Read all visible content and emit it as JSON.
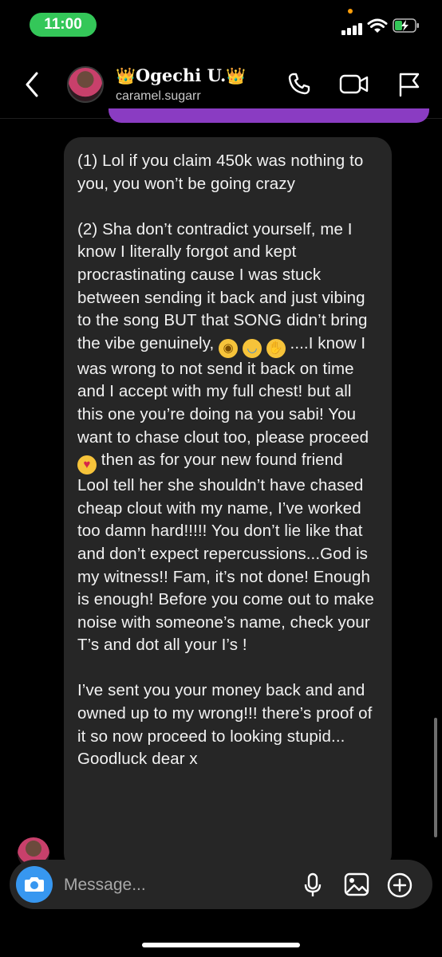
{
  "status_bar": {
    "time": "11:00",
    "battery_state": "charging"
  },
  "header": {
    "back_icon": "chevron-left-icon",
    "crown_left": "👑",
    "display_name": "Ogechi U.",
    "crown_right": "👑",
    "username": "caramel.sugarr",
    "actions": [
      "phone-icon",
      "video-icon",
      "flag-icon"
    ]
  },
  "message": {
    "p1": "(1) Lol if you claim 450k was nothing to you, you won’t be going crazy",
    "p2a": "(2) Sha don’t contradict yourself, me I know I literally forgot and kept procrastinating cause I was stuck between sending it back and just vibing to the song BUT that SONG didn’t bring the vibe genuinely, ",
    "p2b": " ....I know I was wrong to not send it back on time and I accept with my full chest! but all this one you’re doing na you sabi! You want to chase clout too, please proceed ",
    "p2c": " then as for your new found friend Lool tell her she shouldn’t have chased cheap clout with my name, I’ve worked too damn hard!!!!! You don’t lie like that and don’t expect repercussions...God is my witness!! Fam, it’s not done! Enough is enough! Before you come out to make noise with someone’s name, check your T’s and dot all your I’s !",
    "p3": "I’ve sent you your money back and and owned up to my wrong!!! there’s proof of it so now proceed to looking stupid... Goodluck dear x",
    "emojis": [
      "dizzy-face-emoji",
      "sob-emoji",
      "shushing-face-emoji",
      "kiss-emoji"
    ]
  },
  "composer": {
    "placeholder": "Message...",
    "buttons": [
      "camera-icon",
      "microphone-icon",
      "gallery-icon",
      "add-icon"
    ],
    "accent": "#3797f0"
  },
  "colors": {
    "bubble": "#262626",
    "time_pill": "#34c759",
    "header_accent": "#8a3cc2"
  }
}
